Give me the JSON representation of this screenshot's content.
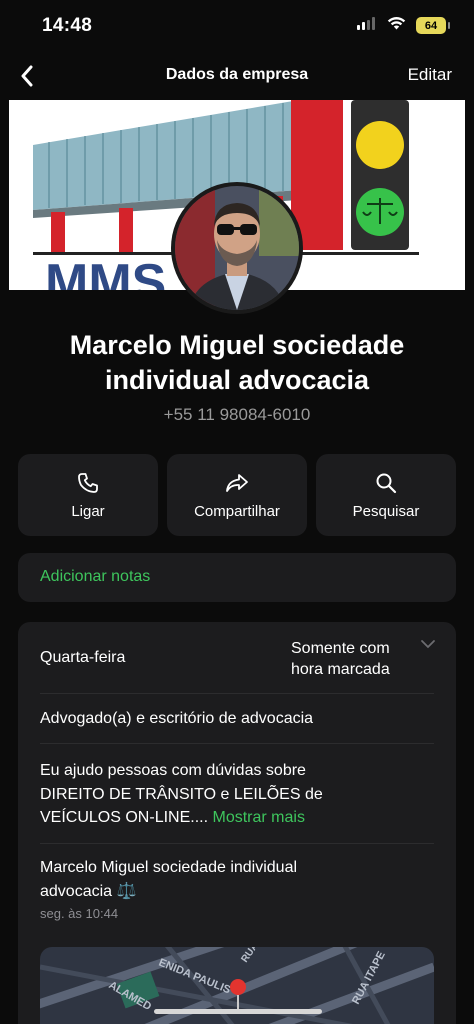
{
  "status_bar": {
    "time": "14:48",
    "battery": "64"
  },
  "nav": {
    "title": "Dados da empresa",
    "edit_label": "Editar"
  },
  "cover": {
    "logo_text": "MMS"
  },
  "business": {
    "name": "Marcelo Miguel sociedade individual advocacia",
    "phone": "+55 11 98084-6010"
  },
  "actions": [
    {
      "label": "Ligar",
      "icon": "phone-icon"
    },
    {
      "label": "Compartilhar",
      "icon": "share-icon"
    },
    {
      "label": "Pesquisar",
      "icon": "search-icon"
    }
  ],
  "notes": {
    "label": "Adicionar notas"
  },
  "hours": {
    "day": "Quarta-feira",
    "status_line1": "Somente com",
    "status_line2": "hora marcada"
  },
  "category": "Advogado(a) e escritório de advocacia",
  "about": {
    "line1": "Eu ajudo pessoas com dúvidas sobre",
    "line2": "DIREITO DE TRÂNSITO e LEILÕES de",
    "line3": "VEÍCULOS ON-LINE....",
    "more": "Mostrar mais"
  },
  "status_update": {
    "line1": "Marcelo Miguel sociedade individual",
    "line2": "advocacia ⚖️",
    "time": "seg. às 10:44"
  },
  "map": {
    "labels": [
      "ENIDA PAULIS",
      "RUA",
      "ALAMED",
      "RUA ITAPE"
    ]
  },
  "colors": {
    "accent": "#3ec55d",
    "card": "#1c1c1e",
    "background": "#0b0b0b"
  }
}
